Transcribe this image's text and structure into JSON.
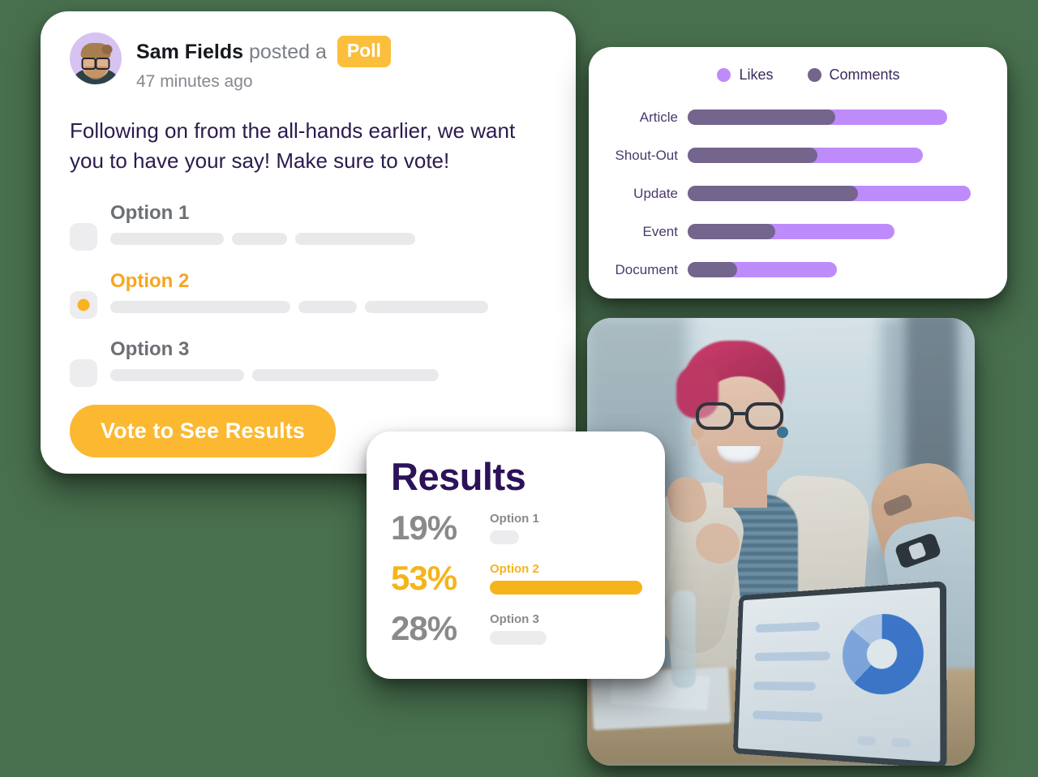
{
  "background_color": "#48704E",
  "poll_card": {
    "author": "Sam Fields",
    "byline_middle": " posted a ",
    "badge": "Poll",
    "timestamp": "47 minutes ago",
    "body": "Following on from the all-hands earlier, we want you to have your say! Make sure to vote!",
    "options": [
      {
        "label": "Option 1",
        "selected": false,
        "skeleton_widths": [
          140,
          68,
          148
        ]
      },
      {
        "label": "Option 2",
        "selected": true,
        "skeleton_widths": [
          222,
          72,
          152
        ]
      },
      {
        "label": "Option 3",
        "selected": false,
        "skeleton_widths": [
          165,
          230
        ]
      }
    ],
    "vote_button": "Vote to See Results",
    "accent_color": "#FBB830",
    "selected_option": "Option 2"
  },
  "chart_card": {
    "legend": [
      {
        "label": "Likes",
        "color": "#BE8CFA"
      },
      {
        "label": "Comments",
        "color": "#74658C"
      }
    ]
  },
  "chart_data": {
    "type": "bar",
    "orientation": "horizontal",
    "stacked_overlay": true,
    "title": "",
    "xlabel": "",
    "ylabel": "",
    "categories": [
      "Article",
      "Shout-Out",
      "Update",
      "Event",
      "Document"
    ],
    "series": [
      {
        "name": "Likes",
        "color": "#BE8CFA",
        "values": [
          320,
          290,
          349,
          255,
          184
        ]
      },
      {
        "name": "Comments",
        "color": "#74658C",
        "values": [
          182,
          160,
          210,
          108,
          61
        ]
      }
    ],
    "xlim": [
      0,
      360
    ],
    "grid": false,
    "legend_position": "top-center",
    "note": "Likes bar is the full bar length; Comments bar is drawn overlaid from the left"
  },
  "results_card": {
    "title": "Results",
    "rows": [
      {
        "percent": "19%",
        "label": "Option 1",
        "value": 19,
        "highlight": false
      },
      {
        "percent": "53%",
        "label": "Option 2",
        "value": 53,
        "highlight": true
      },
      {
        "percent": "28%",
        "label": "Option 3",
        "value": 28,
        "highlight": false
      }
    ],
    "accent_color": "#F5B41A"
  },
  "photo_card": {
    "alt": "Smiling woman with pink hair and glasses in a beige blazer at an office meeting table beside a colleague, with an open laptop showing a blue donut chart"
  }
}
